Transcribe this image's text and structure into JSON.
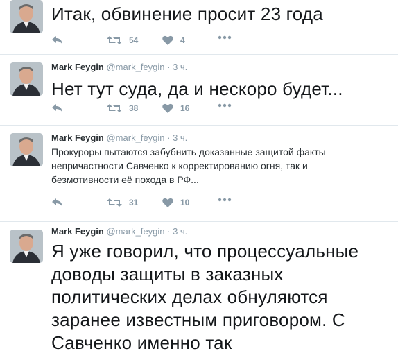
{
  "tweets": [
    {
      "name": "",
      "handle": "",
      "time": "",
      "text": "Итак, обвинение просит 23 года",
      "retweets": "54",
      "likes": "4"
    },
    {
      "name": "Mark Feygin",
      "handle": "@mark_feygin",
      "time": "· 3 ч.",
      "text": "Нет тут суда, да и нескоро будет...",
      "retweets": "38",
      "likes": "16"
    },
    {
      "name": "Mark Feygin",
      "handle": "@mark_feygin",
      "time": "· 3 ч.",
      "text": "Прокуроры пытаются забубнить доказанные защитой факты непричастности Савченко к корректированию огня, так и безмотивности её похода в РФ...",
      "retweets": "31",
      "likes": "10"
    },
    {
      "name": "Mark Feygin",
      "handle": "@mark_feygin",
      "time": "· 3 ч.",
      "text": "Я уже говорил, что процессуальные доводы защиты в заказных политических делах обнуляются заранее известным приговором. С Савченко именно так",
      "retweets": "",
      "likes": ""
    }
  ],
  "icons": {
    "reply": "reply-icon",
    "retweet": "retweet-icon",
    "like": "heart-icon",
    "more": "more-icon"
  },
  "colors": {
    "action_gray": "#8899a6",
    "divider": "#e1e8ed",
    "text": "#14171a"
  }
}
